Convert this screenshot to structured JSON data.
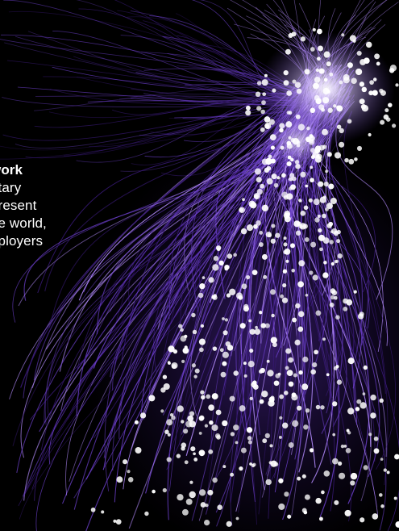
{
  "caption": {
    "title": "work",
    "lines": [
      "ntary",
      "present",
      "he world,",
      "nployers"
    ]
  },
  "artwork": {
    "description_icon": "fiber-optic-strands-illustration",
    "colors": {
      "background": "#000000",
      "strand_deep": "#3a1a7a",
      "strand_mid": "#6a3ec8",
      "strand_light": "#b48cff",
      "glow": "#e8dcff",
      "dot": "#ffffff"
    }
  }
}
